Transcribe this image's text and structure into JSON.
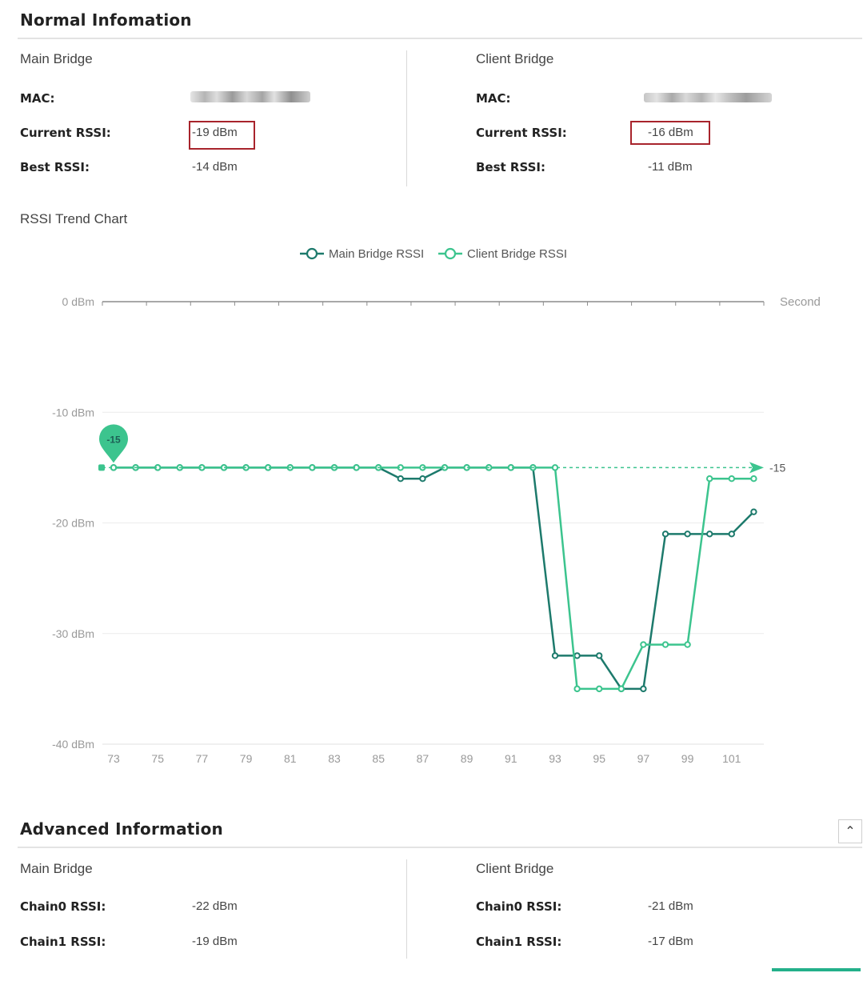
{
  "normal": {
    "title": "Normal Infomation",
    "main": {
      "title": "Main Bridge",
      "mac_label": "MAC:",
      "current_label": "Current RSSI:",
      "current_value": "-19 dBm",
      "best_label": "Best RSSI:",
      "best_value": "-14 dBm"
    },
    "client": {
      "title": "Client Bridge",
      "mac_label": "MAC:",
      "current_label": "Current RSSI:",
      "current_value": "-16 dBm",
      "best_label": "Best RSSI:",
      "best_value": "-11 dBm"
    }
  },
  "chart_title": "RSSI Trend Chart",
  "chart_data": {
    "type": "line",
    "x": [
      73,
      74,
      75,
      76,
      77,
      78,
      79,
      80,
      81,
      82,
      83,
      84,
      85,
      86,
      87,
      88,
      89,
      90,
      91,
      92,
      93,
      94,
      95,
      96,
      97,
      98,
      99,
      100,
      101,
      102
    ],
    "x_ticks": [
      73,
      75,
      77,
      79,
      81,
      83,
      85,
      87,
      89,
      91,
      93,
      95,
      97,
      99,
      101
    ],
    "x_unit": "Second",
    "y_ticks": [
      "0 dBm",
      "-10 dBm",
      "-20 dBm",
      "-30 dBm",
      "-40 dBm"
    ],
    "ylim": [
      -40,
      0
    ],
    "series": [
      {
        "name": "Main Bridge RSSI",
        "color": "#1d7a6c",
        "values": [
          -15,
          -15,
          -15,
          -15,
          -15,
          -15,
          -15,
          -15,
          -15,
          -15,
          -15,
          -15,
          -15,
          -16,
          -16,
          -15,
          -15,
          -15,
          -15,
          -15,
          -32,
          -32,
          -32,
          -35,
          -35,
          -21,
          -21,
          -21,
          -21,
          -19
        ]
      },
      {
        "name": "Client Bridge RSSI",
        "color": "#3cc48e",
        "values": [
          -15,
          -15,
          -15,
          -15,
          -15,
          -15,
          -15,
          -15,
          -15,
          -15,
          -15,
          -15,
          -15,
          -15,
          -15,
          -15,
          -15,
          -15,
          -15,
          -15,
          -15,
          -35,
          -35,
          -35,
          -31,
          -31,
          -31,
          -16,
          -16,
          -16
        ]
      }
    ],
    "mark_line_value": -15,
    "mark_line_label": "-15",
    "mark_point_label": "-15",
    "grid": true,
    "legend_position": "top-center"
  },
  "advanced": {
    "title": "Advanced Information",
    "collapse_glyph": "⌃",
    "main": {
      "title": "Main Bridge",
      "chain0_label": "Chain0 RSSI:",
      "chain0_value": "-22 dBm",
      "chain1_label": "Chain1 RSSI:",
      "chain1_value": "-19 dBm"
    },
    "client": {
      "title": "Client Bridge",
      "chain0_label": "Chain0 RSSI:",
      "chain0_value": "-21 dBm",
      "chain1_label": "Chain1 RSSI:",
      "chain1_value": "-17 dBm"
    }
  }
}
